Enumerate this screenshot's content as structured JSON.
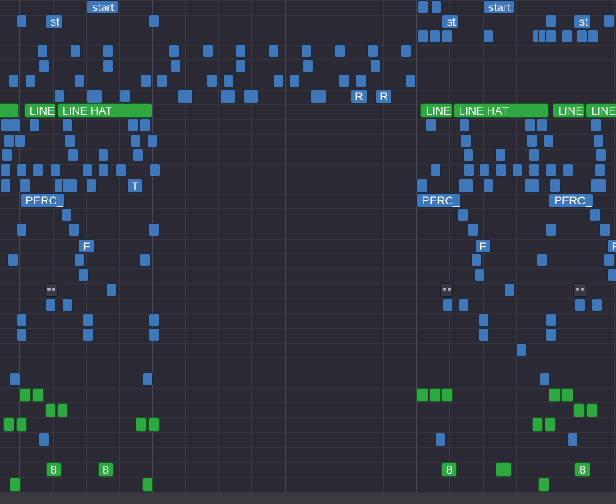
{
  "labels": {
    "start": "start",
    "st": "st",
    "R": "R",
    "line": "LINE",
    "line_hat": "LINE HAT",
    "line_trunc": "LINE",
    "perc": "PERC_",
    "T": "T",
    "F": "F",
    "eight": "8"
  },
  "colors": {
    "background": "#2b2934",
    "note_blue": "#3f77b9",
    "note_green": "#2fa842",
    "grid_line": "#3a3845",
    "footer": "#3b3a40"
  }
}
